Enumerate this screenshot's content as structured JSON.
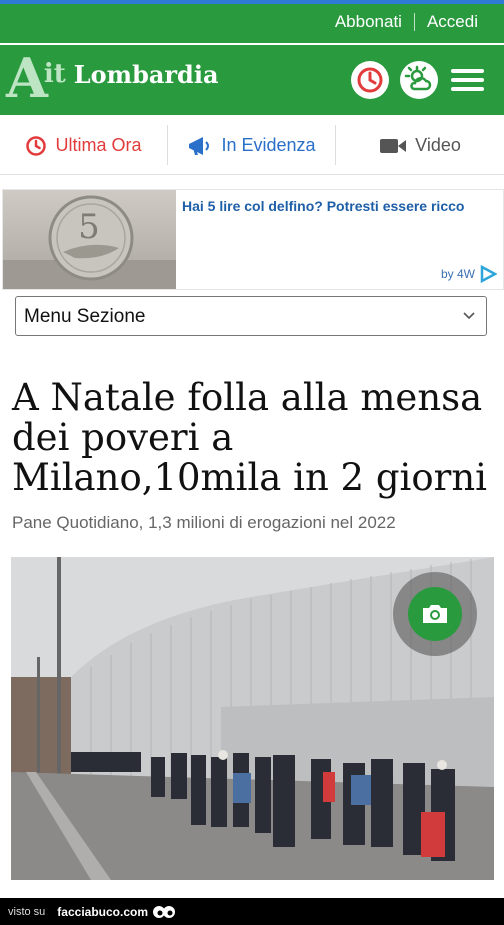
{
  "topbar": {
    "subscribe": "Abbonati",
    "login": "Accedi"
  },
  "header": {
    "logo_a": "A",
    "logo_it": "it",
    "logo_region": "Lombardia",
    "icons": [
      "clock-icon",
      "weather-icon",
      "menu-icon"
    ]
  },
  "nav": [
    {
      "label": "Ultima Ora",
      "icon": "clock-icon",
      "color": "#e23b3b"
    },
    {
      "label": "In Evidenza",
      "icon": "megaphone-icon",
      "color": "#2a6fc9"
    },
    {
      "label": "Video",
      "icon": "video-camera-icon",
      "color": "#555555"
    }
  ],
  "ad": {
    "title": "Hai 5 lire col delfino? Potresti essere ricco",
    "coin_text": "5",
    "by": "by 4W"
  },
  "section_select": {
    "value": "Menu Sezione"
  },
  "article": {
    "headline": "A Natale folla alla mensa dei poveri a Milano,10mila in 2 giorni",
    "subheadline": "Pane Quotidiano, 1,3 milioni di erogazioni nel 2022"
  },
  "footer": {
    "seen_on": "visto su",
    "brand": "facciabuco.com"
  },
  "colors": {
    "brand_green": "#2a9a3f",
    "top_line": "#2e7bd6",
    "link_blue": "#1f5fa8"
  }
}
